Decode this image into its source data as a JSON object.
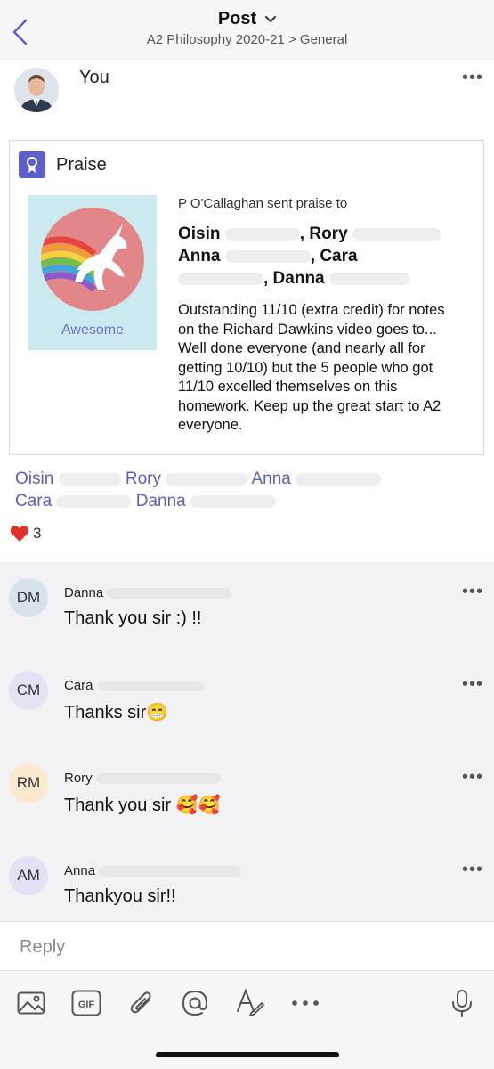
{
  "header": {
    "title": "Post",
    "breadcrumb": "A2 Philosophy 2020-21 > General"
  },
  "post": {
    "author": "You",
    "more": "•••",
    "card": {
      "type_label": "Praise",
      "tile_label": "Awesome",
      "sent_line": "P O'Callaghan sent praise to",
      "names": {
        "line1a": "Oisin",
        "line1b": ", Rory",
        "line2a": "Anna",
        "line2b": ", Cara",
        "line3a": ", Danna"
      },
      "message": "Outstanding 11/10 (extra credit) for notes on the Richard Dawkins video goes to... Well done everyone (and nearly all for getting 10/10) but the 5 people who got 11/10 excelled themselves on this homework. Keep up the great start to A2 everyone."
    },
    "recipients": {
      "r1": "Oisin",
      "r2": "Rory",
      "r3": "Anna",
      "r4": "Cara",
      "r5": "Danna"
    },
    "reactions": {
      "count": "3",
      "color": "#e0322b"
    }
  },
  "comments": [
    {
      "initials": "DM",
      "name": "Danna",
      "text": "Thank you sir :) !!",
      "avatar_color": "#d7e2ea"
    },
    {
      "initials": "CM",
      "name": "Cara",
      "text": "Thanks sir😁",
      "avatar_color": "#e5e2f3"
    },
    {
      "initials": "RM",
      "name": "Rory",
      "text": "Thank you sir 🥰🥰",
      "avatar_color": "#fbe8cf"
    },
    {
      "initials": "AM",
      "name": "Anna",
      "text": "Thankyou sir!!",
      "avatar_color": "#e3e2f4"
    }
  ],
  "reply": {
    "placeholder": "Reply"
  },
  "toolbar": [
    "image-icon",
    "gif-icon",
    "attach-icon",
    "mention-icon",
    "format-icon",
    "more-icon",
    "mic-icon"
  ],
  "colors": {
    "accent": "#5b5fc7",
    "tile_bg": "#cbe9ef",
    "unicorn_circle": "#e2868a"
  }
}
